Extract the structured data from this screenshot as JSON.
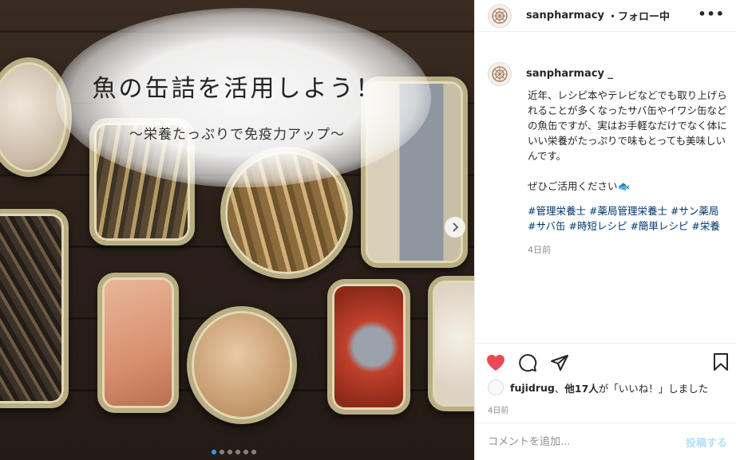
{
  "image": {
    "title": "魚の缶詰を活用しよう！",
    "subtitle": "〜栄養たっぷりで免疫力アップ〜",
    "carousel": {
      "total": 6,
      "active_index": 0
    }
  },
  "header": {
    "username": "sanpharmacy",
    "follow_status": "・フォロー中",
    "more_icon": "more-horizontal-icon"
  },
  "caption": {
    "username": "sanpharmacy _",
    "body": "近年、レシピ本やテレビなどでも取り上げられることが多くなったサバ缶やイワシ缶などの魚缶ですが、実はお手軽なだけでなく体にいい栄養がたっぷりで味もとっても美味しいんです。\n\nぜひご活用ください🐟",
    "hashtags": [
      "#管理栄養士",
      "#薬局管理栄養士",
      "#サン薬局",
      "#サバ缶",
      "#時短レシピ",
      "#簡単レシピ",
      "#栄養"
    ],
    "time": "4日前"
  },
  "actions": {
    "like_icon": "heart-icon",
    "comment_icon": "comment-icon",
    "share_icon": "share-icon",
    "save_icon": "bookmark-icon",
    "liked": true,
    "like_color": "#ed4956"
  },
  "likes": {
    "user": "fujidrug",
    "separator": "、",
    "others": "他17人",
    "suffix": "が「いいね！」しました"
  },
  "post_time": "4日前",
  "comment": {
    "placeholder": "コメントを追加...",
    "post_label": "投稿する"
  }
}
